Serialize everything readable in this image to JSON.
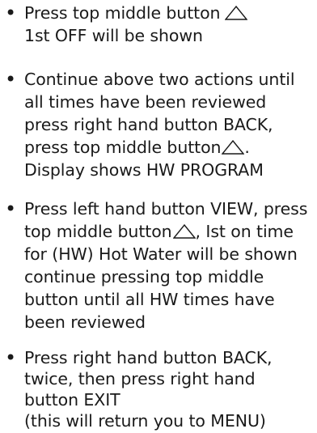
{
  "steps": [
    {
      "lines": [
        {
          "before": "Press top middle button",
          "icon": "triangle-up-icon",
          "after": ""
        },
        {
          "before": "1st OFF will be shown"
        }
      ]
    },
    {
      "lines": [
        {
          "before": "Continue above two actions until"
        },
        {
          "before": "all times have been reviewed"
        },
        {
          "before": "press right hand button BACK,"
        },
        {
          "before": "press top middle button",
          "icon": "triangle-up-icon",
          "after": "."
        },
        {
          "before": "Display shows HW PROGRAM"
        }
      ]
    },
    {
      "lines": [
        {
          "before": "Press left hand button VIEW, press"
        },
        {
          "before": "top middle button",
          "icon": "triangle-up-icon",
          "after": ", Ist on time"
        },
        {
          "before": "for (HW) Hot Water will be shown"
        },
        {
          "before": "continue pressing top middle"
        },
        {
          "before": "button until all HW times have"
        },
        {
          "before": "been reviewed"
        }
      ]
    },
    {
      "lines": [
        {
          "before": "Press right hand button BACK,"
        },
        {
          "before": "twice, then press right hand"
        },
        {
          "before": "button EXIT"
        },
        {
          "before": "(this will return you to MENU)"
        }
      ]
    }
  ]
}
